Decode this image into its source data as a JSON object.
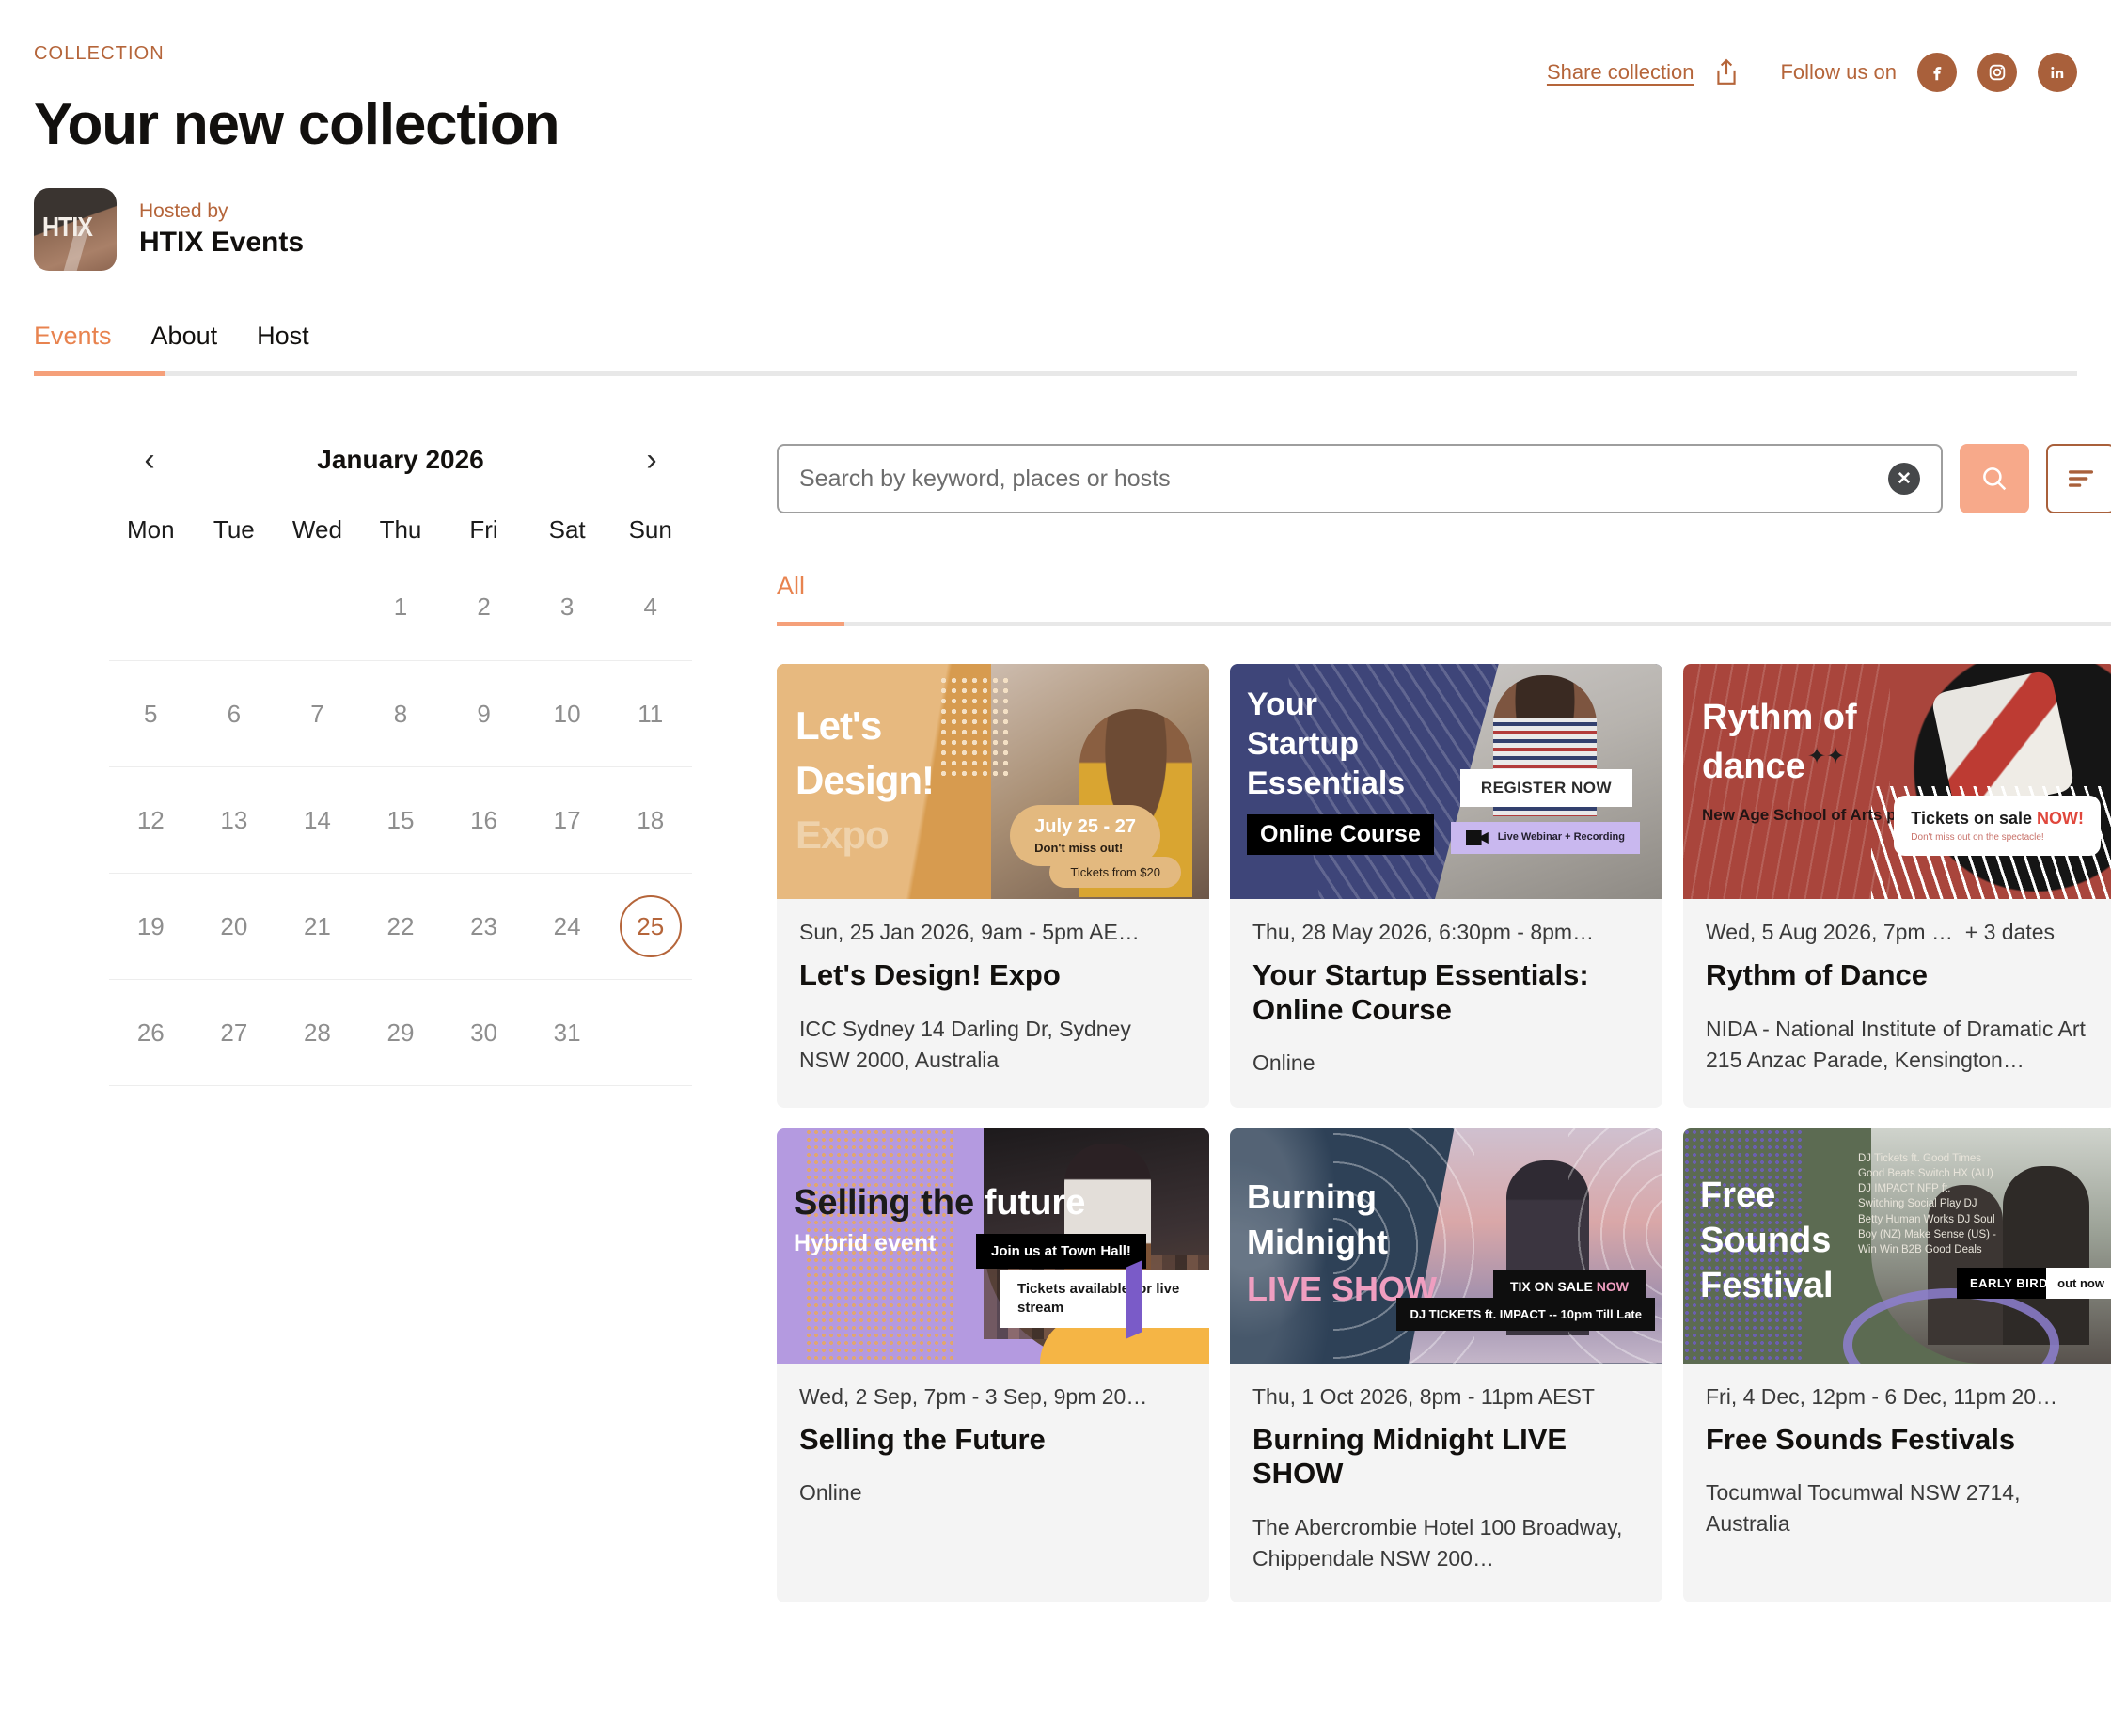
{
  "header": {
    "eyebrow": "COLLECTION",
    "title": "Your new collection",
    "hosted_by_label": "Hosted by",
    "host_name": "HTIX Events",
    "host_logo_text": "HTIX",
    "share_label": "Share collection",
    "follow_label": "Follow us on",
    "social": [
      {
        "name": "facebook-icon",
        "glyph": "f"
      },
      {
        "name": "instagram-icon",
        "glyph": "▢"
      },
      {
        "name": "linkedin-icon",
        "glyph": "in"
      }
    ]
  },
  "nav": {
    "tabs": [
      {
        "label": "Events",
        "active": true
      },
      {
        "label": "About",
        "active": false
      },
      {
        "label": "Host",
        "active": false
      }
    ]
  },
  "calendar": {
    "month_label": "January 2026",
    "prev_icon": "‹",
    "next_icon": "›",
    "weekdays": [
      "Mon",
      "Tue",
      "Wed",
      "Thu",
      "Fri",
      "Sat",
      "Sun"
    ],
    "weeks": [
      [
        "",
        "",
        "",
        "1",
        "2",
        "3",
        "4"
      ],
      [
        "5",
        "6",
        "7",
        "8",
        "9",
        "10",
        "11"
      ],
      [
        "12",
        "13",
        "14",
        "15",
        "16",
        "17",
        "18"
      ],
      [
        "19",
        "20",
        "21",
        "22",
        "23",
        "24",
        "25"
      ],
      [
        "26",
        "27",
        "28",
        "29",
        "30",
        "31",
        ""
      ]
    ],
    "selected_day": "25",
    "accent_color": "#b5653a"
  },
  "search": {
    "value": "",
    "placeholder": "Search by keyword, places or hosts",
    "clear_icon": "✕",
    "search_icon": "search-icon",
    "filter_icon": "sort-filter-icon",
    "search_button_color": "#f7a98a",
    "filter_button_color": "#a9603b"
  },
  "filters": {
    "tabs": [
      {
        "label": "All",
        "active": true
      }
    ]
  },
  "events": [
    {
      "date": "Sun, 25 Jan 2026, 9am - 5pm AE…",
      "extra": "",
      "title": "Let's Design! Expo",
      "venue": "ICC Sydney 14 Darling Dr, Sydney NSW 2000, Australia",
      "art": {
        "line1": "Let's",
        "line2": "Design!",
        "line3": "Expo",
        "badge_title": "July 25 - 27",
        "badge_sub": "Don't miss out!",
        "badge2": "Tickets from $20"
      }
    },
    {
      "date": "Thu, 28 May 2026, 6:30pm - 8pm…",
      "extra": "",
      "title": "Your Startup Essentials: Online Course",
      "venue": "Online",
      "art": {
        "line1": "Your",
        "line2": "Startup",
        "line3": "Essentials",
        "tag": "Online Course",
        "cta": "REGISTER NOW",
        "webinar": "Live Webinar + Recording"
      }
    },
    {
      "date": "Wed, 5 Aug 2026, 7pm …",
      "extra": "+ 3 dates",
      "title": "Rythm of Dance",
      "venue": "NIDA - National Institute of Dramatic Art 215 Anzac Parade, Kensington…",
      "art": {
        "line1": "Rythm of",
        "line2": "dance",
        "sub": "New Age School of Arts presents",
        "ticket": "Tickets on sale ",
        "ticket_em": "NOW!",
        "ticket_sub": "Don't miss out on the spectacle!"
      }
    },
    {
      "date": "Wed, 2 Sep, 7pm - 3 Sep, 9pm 20…",
      "extra": "",
      "title": "Selling the Future",
      "venue": "Online",
      "art": {
        "line1a": "Selling the ",
        "line1b": "future",
        "line2": "Hybrid event",
        "blk": "Join us at Town Hall!",
        "wht": "Tickets available for live stream"
      }
    },
    {
      "date": "Thu, 1 Oct 2026, 8pm - 11pm AEST",
      "extra": "",
      "title": "Burning Midnight LIVE SHOW",
      "venue": "The Abercrombie Hotel 100 Broadway, Chippendale NSW 200…",
      "art": {
        "line1": "Burning",
        "line2": "Midnight",
        "line3": "LIVE SHOW",
        "tix": "TIX ON SALE ",
        "tix_em": "NOW",
        "dj": "DJ TICKETS ft. IMPACT  -- 10pm Till Late"
      }
    },
    {
      "date": "Fri, 4 Dec, 12pm - 6 Dec, 11pm 20…",
      "extra": "",
      "title": "Free Sounds Festivals",
      "venue": "Tocumwal Tocumwal NSW 2714, Australia",
      "art": {
        "line1": "Free",
        "line2": "Sounds",
        "line3": "Festival",
        "lineup": "DJ Tickets ft. Good Times Good Beats Switch HX (AU) DJ IMPACT NFP ft. Switching Social Play DJ Betty Human Works DJ Soul Boy (NZ) Make Sense (US) - Win Win B2B Good Deals",
        "early_bird": "EARLY BIRD",
        "out_now": "out now"
      }
    }
  ]
}
